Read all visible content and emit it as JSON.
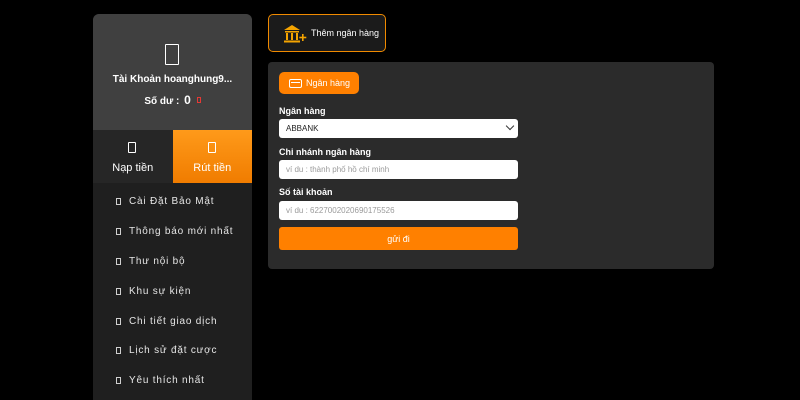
{
  "sidebar": {
    "account_name": "Tài Khoản hoanghung9...",
    "balance_label": "Số dư :",
    "balance_value": "0",
    "tabs": [
      {
        "label": "Nạp tiền",
        "icon": "deposit-icon"
      },
      {
        "label": "Rút tiền",
        "icon": "withdraw-icon",
        "active": true
      }
    ],
    "menu": [
      {
        "label": "Cài Đặt Bảo Mật"
      },
      {
        "label": "Thông báo mới nhất"
      },
      {
        "label": "Thư nội bộ"
      },
      {
        "label": "Khu sự kiện"
      },
      {
        "label": "Chi tiết giao dịch"
      },
      {
        "label": "Lịch sử đặt cược"
      },
      {
        "label": "Yêu thích nhất"
      }
    ]
  },
  "header": {
    "add_bank_label": "Thêm ngân hàng"
  },
  "form": {
    "tab_label": "Ngân hàng",
    "bank_label": "Ngân hàng",
    "bank_value": "ABBANK",
    "branch_label": "Chi nhánh ngân hàng",
    "branch_placeholder": "ví du : thành phố hồ chí minh",
    "account_label": "Số tài khoản",
    "account_placeholder": "ví du : 6227002020690175526",
    "submit_label": "gửi đi"
  },
  "colors": {
    "accent": "#ff8000",
    "background": "#000000",
    "sidebar": "#1f1f1f",
    "panel": "#2b2b2b"
  }
}
